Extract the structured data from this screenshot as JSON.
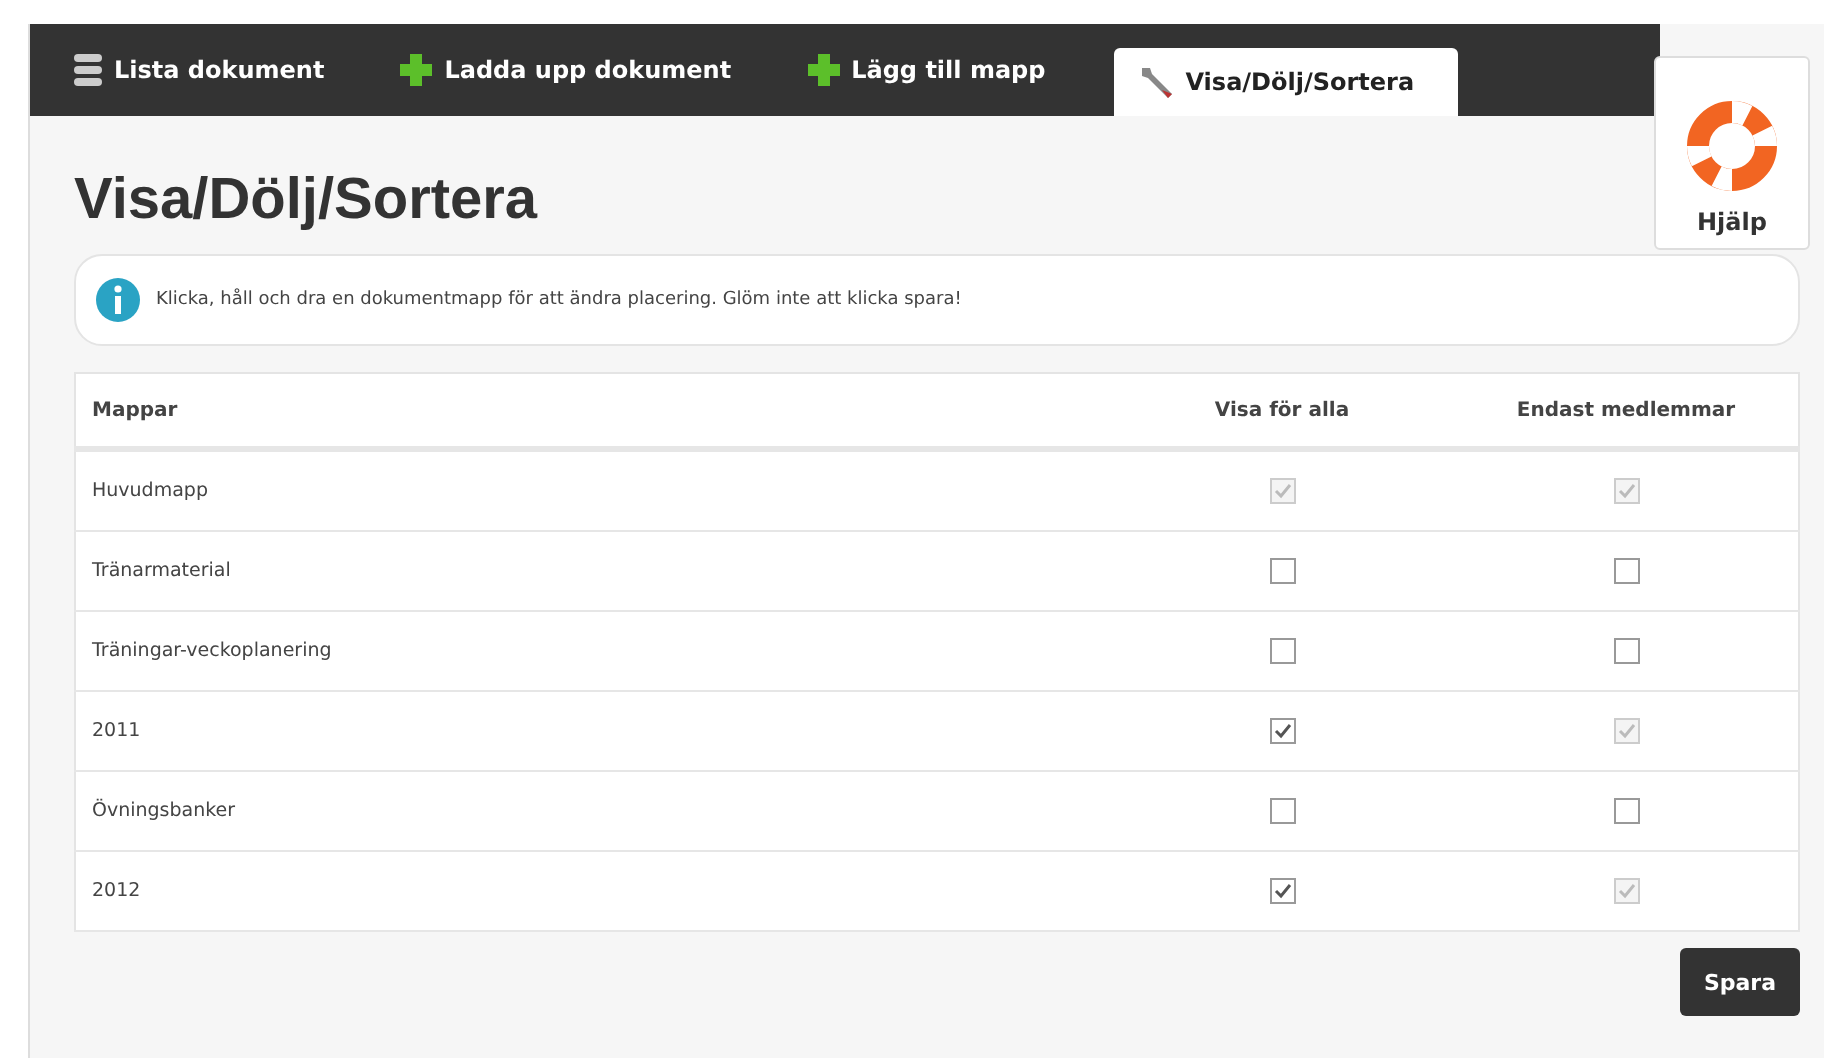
{
  "tabs": [
    {
      "label": "Lista dokument",
      "kind": "list",
      "selected": false
    },
    {
      "label": "Ladda upp dokument",
      "kind": "add",
      "selected": false
    },
    {
      "label": "Lägg till mapp",
      "kind": "add",
      "selected": false
    },
    {
      "label": "Visa/Dölj/Sortera",
      "kind": "tools",
      "selected": true
    }
  ],
  "help": {
    "label": "Hjälp"
  },
  "heading": "Visa/Dölj/Sortera",
  "info": "Klicka, håll och dra en dokumentmapp för att ändra placering. Glöm inte att klicka spara!",
  "table": {
    "columns": [
      "Mappar",
      "Visa för alla",
      "Endast medlemmar"
    ],
    "rows": [
      {
        "name": "Huvudmapp",
        "visa": {
          "checked": true,
          "disabled": true
        },
        "endast": {
          "checked": true,
          "disabled": true
        }
      },
      {
        "name": "Tränarmaterial",
        "visa": {
          "checked": false,
          "disabled": false
        },
        "endast": {
          "checked": false,
          "disabled": false
        }
      },
      {
        "name": "Träningar-veckoplanering",
        "visa": {
          "checked": false,
          "disabled": false
        },
        "endast": {
          "checked": false,
          "disabled": false
        }
      },
      {
        "name": "2011",
        "visa": {
          "checked": true,
          "disabled": false
        },
        "endast": {
          "checked": true,
          "disabled": true
        }
      },
      {
        "name": "Övningsbanker",
        "visa": {
          "checked": false,
          "disabled": false
        },
        "endast": {
          "checked": false,
          "disabled": false
        }
      },
      {
        "name": "2012",
        "visa": {
          "checked": true,
          "disabled": false
        },
        "endast": {
          "checked": true,
          "disabled": true
        }
      }
    ]
  },
  "save_button": "Spara"
}
